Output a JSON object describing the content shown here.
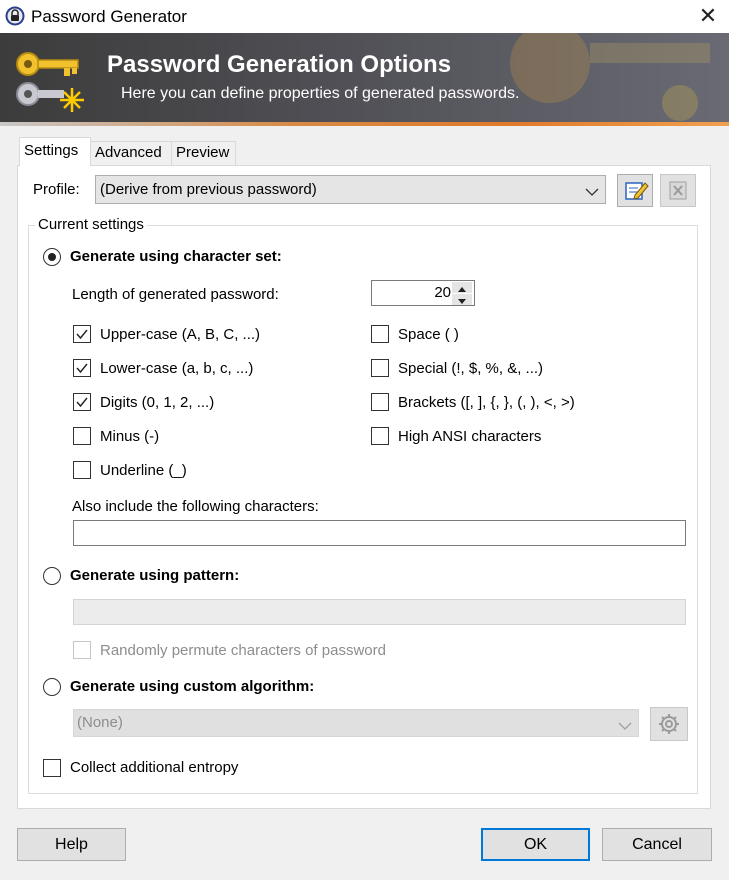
{
  "window": {
    "title": "Password Generator",
    "close_glyph": "✕"
  },
  "banner": {
    "title": "Password Generation Options",
    "subtitle": "Here you can define properties of generated passwords."
  },
  "tabs": [
    {
      "label": "Settings",
      "active": true
    },
    {
      "label": "Advanced",
      "active": false
    },
    {
      "label": "Preview",
      "active": false
    }
  ],
  "profile": {
    "label": "Profile:",
    "selected": "(Derive from previous password)"
  },
  "group": {
    "title": "Current settings"
  },
  "charset": {
    "radio_label": "Generate using character set:",
    "selected": true,
    "length_label": "Length of generated password:",
    "length_value": "20",
    "options_left": [
      {
        "label": "Upper-case (A, B, C, ...)",
        "checked": true
      },
      {
        "label": "Lower-case (a, b, c, ...)",
        "checked": true
      },
      {
        "label": "Digits (0, 1, 2, ...)",
        "checked": true
      },
      {
        "label": "Minus (-)",
        "checked": false
      },
      {
        "label": "Underline (_)",
        "checked": false
      }
    ],
    "options_right": [
      {
        "label": "Space ( )",
        "checked": false
      },
      {
        "label": "Special (!, $, %, &, ...)",
        "checked": false
      },
      {
        "label": "Brackets ([, ], {, }, (, ), <, >)",
        "checked": false
      },
      {
        "label": "High ANSI characters",
        "checked": false
      }
    ],
    "also_include_label": "Also include the following characters:",
    "also_include_value": ""
  },
  "pattern": {
    "radio_label": "Generate using pattern:",
    "selected": false,
    "value": "",
    "permute_label": "Randomly permute characters of password",
    "permute_checked": false
  },
  "custom": {
    "radio_label": "Generate using custom algorithm:",
    "selected": false,
    "algorithm": "(None)"
  },
  "entropy": {
    "label": "Collect additional entropy",
    "checked": false
  },
  "buttons": {
    "help": "Help",
    "ok": "OK",
    "cancel": "Cancel"
  },
  "colors": {
    "accent": "#0078d7",
    "banner_dark": "#3c3c3c",
    "banner_stripe": "#e07a2a"
  }
}
